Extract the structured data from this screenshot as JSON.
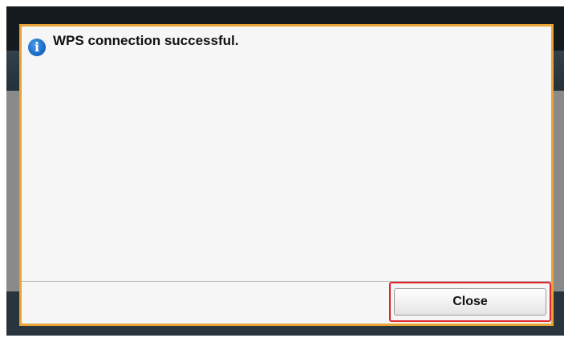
{
  "dialog": {
    "icon": "info-icon",
    "icon_glyph": "i",
    "message": "WPS connection successful.",
    "close_label": "Close"
  },
  "colors": {
    "dialog_border": "#e8a437",
    "highlight": "#e0262a",
    "info_icon": "#1565c0"
  }
}
